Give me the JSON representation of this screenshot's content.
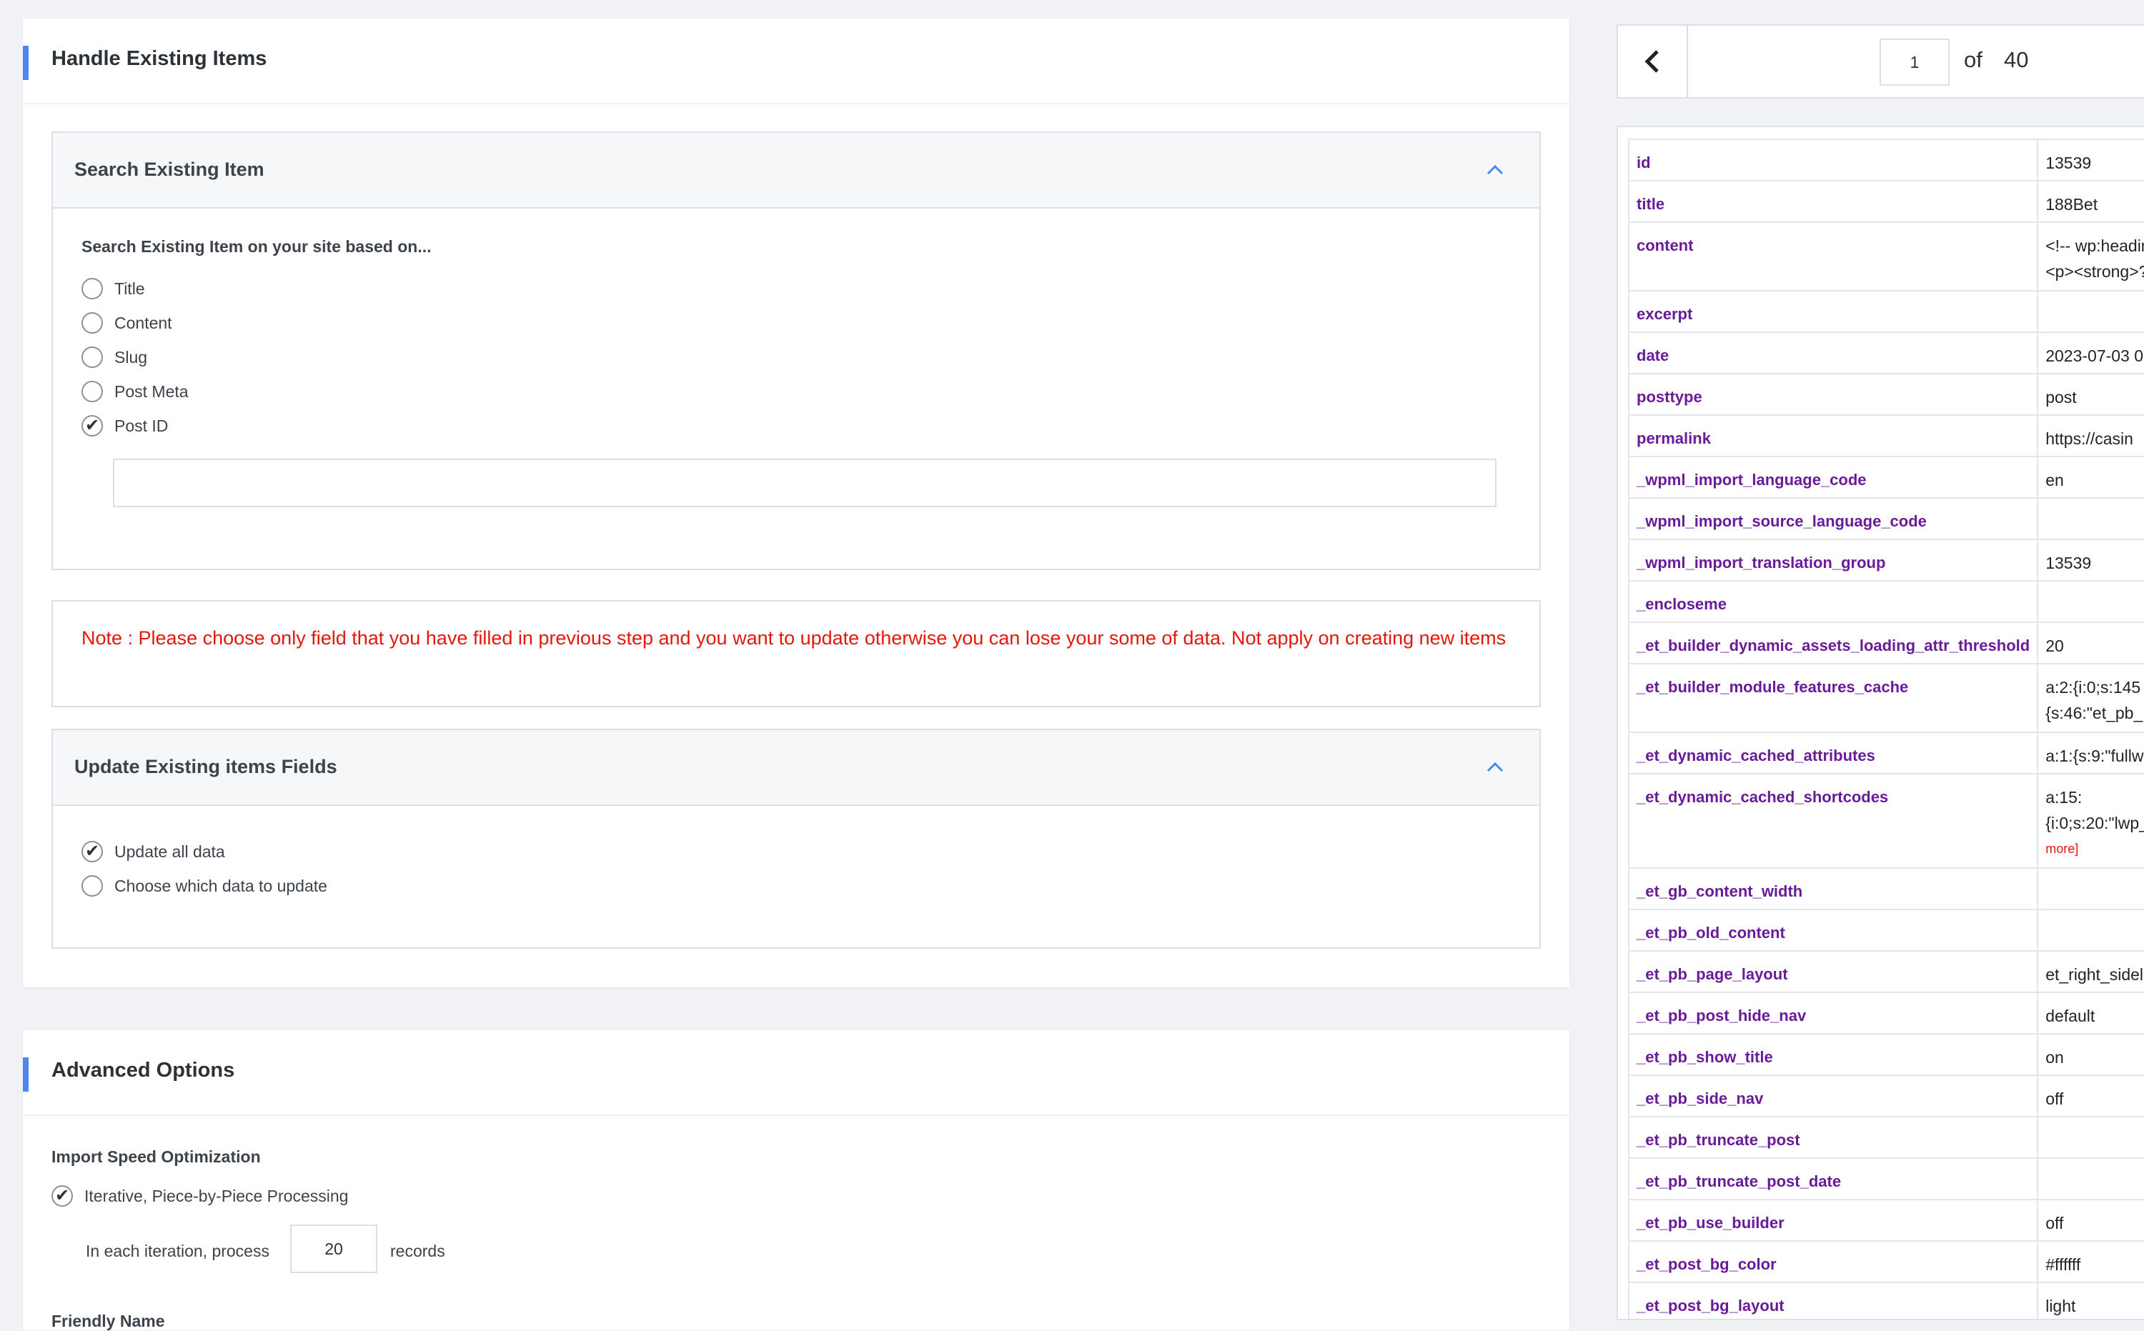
{
  "handle": {
    "title": "Handle Existing Items",
    "search": {
      "title": "Search Existing Item",
      "prompt": "Search Existing Item on your site based on...",
      "options": [
        "Title",
        "Content",
        "Slug",
        "Post Meta",
        "Post ID"
      ],
      "selected": "Post ID",
      "input_value": ""
    },
    "note": "Note : Please choose only field that you have filled in previous step and you want to update otherwise you can lose your some of data. Not apply on creating new items",
    "update": {
      "title": "Update Existing items Fields",
      "options": [
        "Update all data",
        "Choose which data to update"
      ],
      "selected": "Update all data"
    }
  },
  "advanced": {
    "title": "Advanced Options",
    "speed_label": "Import Speed Optimization",
    "iterative_label": "Iterative, Piece-by-Piece Processing",
    "iteration_prefix": "In each iteration, process",
    "iteration_value": "20",
    "iteration_suffix": "records",
    "friendly_name_label": "Friendly Name"
  },
  "pager": {
    "current": "1",
    "of_label": "of",
    "total": "40"
  },
  "record": {
    "rows": [
      {
        "key": "id",
        "value": "13539"
      },
      {
        "key": "title",
        "value": "188Bet"
      },
      {
        "key": "content",
        "value": "<!-- wp:heading",
        "value2": "<p><strong>?"
      },
      {
        "key": "excerpt",
        "value": ""
      },
      {
        "key": "date",
        "value": "2023-07-03 0"
      },
      {
        "key": "posttype",
        "value": "post"
      },
      {
        "key": "permalink",
        "value": "https://casin"
      },
      {
        "key": "_wpml_import_language_code",
        "value": "en"
      },
      {
        "key": "_wpml_import_source_language_code",
        "value": ""
      },
      {
        "key": "_wpml_import_translation_group",
        "value": "13539"
      },
      {
        "key": "_encloseme",
        "value": ""
      },
      {
        "key": "_et_builder_dynamic_assets_loading_attr_threshold",
        "value": "20"
      },
      {
        "key": "_et_builder_module_features_cache",
        "value": "a:2:{i:0;s:145",
        "value2": "{s:46:\"et_pb_"
      },
      {
        "key": "_et_dynamic_cached_attributes",
        "value": "a:1:{s:9:\"fullw"
      },
      {
        "key": "_et_dynamic_cached_shortcodes",
        "value": "a:15:",
        "value2": "{i:0;s:20:\"lwp_",
        "more": "more]"
      },
      {
        "key": "_et_gb_content_width",
        "value": ""
      },
      {
        "key": "_et_pb_old_content",
        "value": ""
      },
      {
        "key": "_et_pb_page_layout",
        "value": "et_right_sidel"
      },
      {
        "key": "_et_pb_post_hide_nav",
        "value": "default"
      },
      {
        "key": "_et_pb_show_title",
        "value": "on"
      },
      {
        "key": "_et_pb_side_nav",
        "value": "off"
      },
      {
        "key": "_et_pb_truncate_post",
        "value": ""
      },
      {
        "key": "_et_pb_truncate_post_date",
        "value": ""
      },
      {
        "key": "_et_pb_use_builder",
        "value": "off"
      },
      {
        "key": "_et_post_bg_color",
        "value": "#ffffff"
      },
      {
        "key": "_et_post_bg_layout",
        "value": "light"
      }
    ]
  },
  "colors": {
    "accent": "#4f86ec",
    "note_red": "#e4170c",
    "key_purple": "#6a1b9a"
  }
}
